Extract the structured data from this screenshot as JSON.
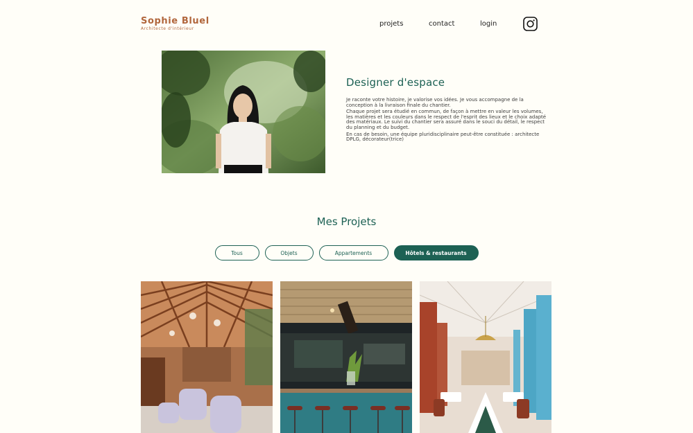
{
  "header": {
    "logo_name": "Sophie Bluel",
    "logo_subtitle": "Architecte d'intérieur",
    "nav": [
      "projets",
      "contact",
      "login"
    ],
    "instagram_icon": "instagram-icon"
  },
  "intro": {
    "title": "Designer d'espace",
    "paragraphs": [
      "Je raconte votre histoire, je valorise vos idées. Je vous accompagne de la conception à la livraison finale du chantier.",
      "Chaque projet sera étudié en commun, de façon à mettre en valeur les volumes, les matières et les couleurs dans le respect de l'esprit des lieux et le choix adapté des matériaux. Le suivi du chantier sera assuré dans le souci du détail, le respect du planning et du budget.",
      "En cas de besoin, une équipe pluridisciplinaire peut-être constituée : architecte DPLG, décorateur(trice)"
    ]
  },
  "projects": {
    "title": "Mes Projets",
    "filters": [
      "Tous",
      "Objets",
      "Appartements",
      "Hôtels & restaurants"
    ],
    "active_filter": "Hôtels & restaurants"
  },
  "colors": {
    "brand": "#b1663c",
    "accent": "#1d6154",
    "background": "#fffef8"
  }
}
